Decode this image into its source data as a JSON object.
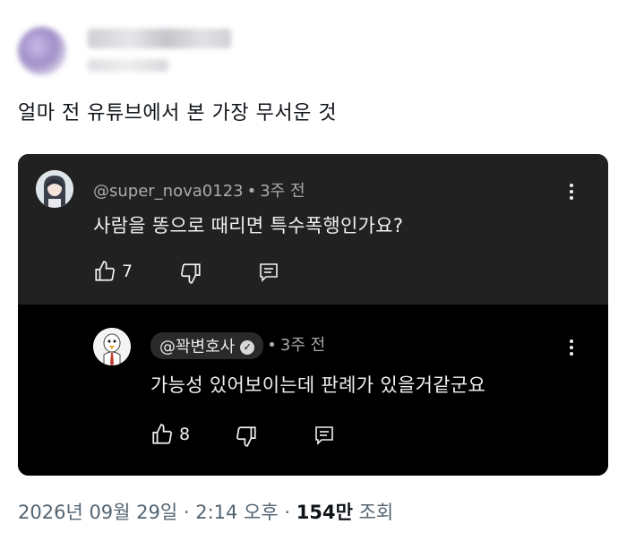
{
  "tweet": {
    "text": "얼마 전 유튜브에서 본 가장 무서운 것"
  },
  "embedded": {
    "comment": {
      "handle": "@super_nova0123",
      "time": "3주 전",
      "text": "사람을 똥으로 때리면 특수폭행인가요?",
      "likes": "7"
    },
    "reply": {
      "handle": "@꽉변호사",
      "time": "3주 전",
      "text": "가능성 있어보이는데 판례가 있을거같군요",
      "likes": "8"
    }
  },
  "footer": {
    "datetime": "2026년 09월 29일 · 2:14 오후",
    "sep": "·",
    "views_count": "154만",
    "views_label": "조회"
  }
}
